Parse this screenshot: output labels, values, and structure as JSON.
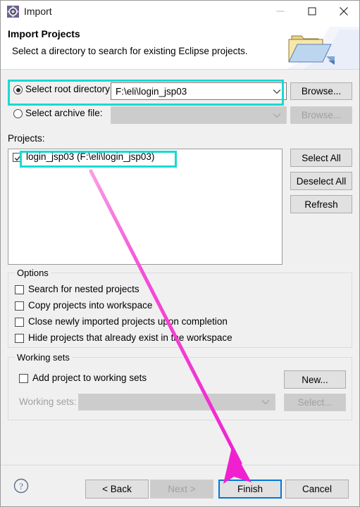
{
  "window": {
    "title": "Import",
    "icon": "eclipse-import-icon",
    "controls": {
      "minimize": "minimize-icon",
      "maximize": "maximize-icon",
      "close": "close-icon"
    }
  },
  "header": {
    "title": "Import Projects",
    "description": "Select a directory to search for existing Eclipse projects.",
    "artwork": "folder-import-icon"
  },
  "source": {
    "root_directory": {
      "radio_label": "Select root directory:",
      "selected": true,
      "value": "F:\\eli\\login_jsp03",
      "browse_label": "Browse...",
      "browse_enabled": true
    },
    "archive_file": {
      "radio_label": "Select archive file:",
      "selected": false,
      "value": "",
      "browse_label": "Browse...",
      "browse_enabled": false
    }
  },
  "projects": {
    "label": "Projects:",
    "items": [
      {
        "label": "login_jsp03 (F:\\eli\\login_jsp03)",
        "checked": true
      }
    ],
    "buttons": {
      "select_all": "Select All",
      "deselect_all": "Deselect All",
      "refresh": "Refresh"
    }
  },
  "options": {
    "title": "Options",
    "items": [
      {
        "label": "Search for nested projects",
        "checked": false
      },
      {
        "label": "Copy projects into workspace",
        "checked": false
      },
      {
        "label": "Close newly imported projects upon completion",
        "checked": false
      },
      {
        "label": "Hide projects that already exist in the workspace",
        "checked": false
      }
    ]
  },
  "working_sets": {
    "title": "Working sets",
    "add_checkbox": {
      "label": "Add project to working sets",
      "checked": false
    },
    "combo_label": "Working sets:",
    "combo_value": "",
    "combo_enabled": false,
    "new_label": "New...",
    "select_label": "Select...",
    "select_enabled": false
  },
  "footer": {
    "help": "help-icon",
    "back_label": "< Back",
    "next_label": "Next >",
    "next_enabled": false,
    "finish_label": "Finish",
    "finish_focused": true,
    "cancel_label": "Cancel"
  },
  "annotations": {
    "highlight_color": "#1ad9d3",
    "arrow_color": "#f020d0",
    "highlight_targets": [
      "select-root-directory-row",
      "project-list-item"
    ],
    "arrow_target": "finish-button"
  }
}
